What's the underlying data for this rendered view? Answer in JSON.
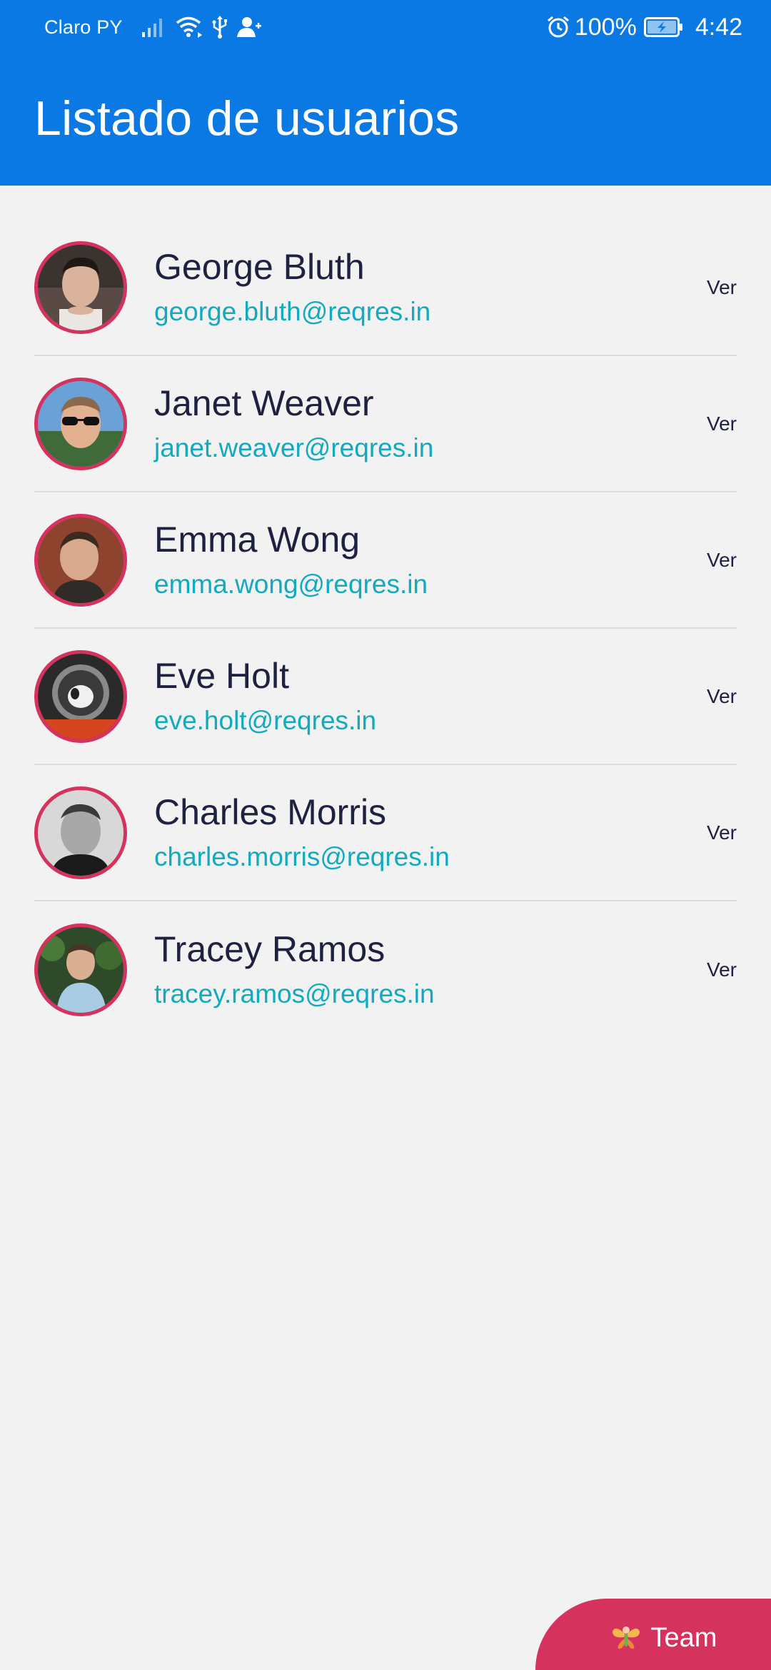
{
  "status_bar": {
    "carrier": "Claro PY",
    "battery_percent": "100%",
    "time": "4:42",
    "icons": [
      "signal-icon",
      "wifi-icon",
      "usb-icon",
      "account-icon",
      "alarm-icon",
      "battery-charging-icon"
    ]
  },
  "app_bar": {
    "title": "Listado de usuarios",
    "color": "#0a79e3"
  },
  "users": [
    {
      "name": "George Bluth",
      "email": "george.bluth@reqres.in",
      "action": "Ver"
    },
    {
      "name": "Janet Weaver",
      "email": "janet.weaver@reqres.in",
      "action": "Ver"
    },
    {
      "name": "Emma Wong",
      "email": "emma.wong@reqres.in",
      "action": "Ver"
    },
    {
      "name": "Eve Holt",
      "email": "eve.holt@reqres.in",
      "action": "Ver"
    },
    {
      "name": "Charles Morris",
      "email": "charles.morris@reqres.in",
      "action": "Ver"
    },
    {
      "name": "Tracey Ramos",
      "email": "tracey.ramos@reqres.in",
      "action": "Ver"
    }
  ],
  "fab": {
    "label": "Team",
    "icon": "fairy-icon",
    "color": "#d6325e"
  },
  "colors": {
    "name_text": "#1f2140",
    "email_text": "#12aabf",
    "avatar_border": "#d6325e",
    "background": "#f2f2f2"
  }
}
